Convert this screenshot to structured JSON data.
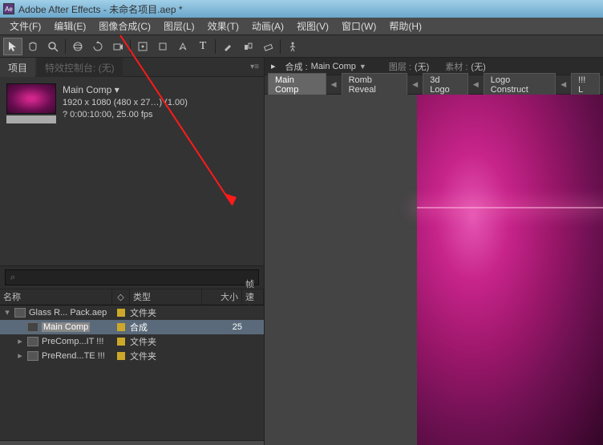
{
  "title": "Adobe After Effects - 未命名项目.aep *",
  "menu": [
    "文件(F)",
    "编辑(E)",
    "图像合成(C)",
    "图层(L)",
    "效果(T)",
    "动画(A)",
    "视图(V)",
    "窗口(W)",
    "帮助(H)"
  ],
  "panel": {
    "projectTab": "项目",
    "fxTab": "特效控制台:  (无)",
    "menuIcon": "▾≡"
  },
  "comp": {
    "name": "Main Comp ▾",
    "dims": "1920 x 1080  (480 x 27…)  (1.00)",
    "time": "? 0:00:10:00, 25.00 fps"
  },
  "search": {
    "placeholder": "⌕"
  },
  "cols": {
    "name": "名称",
    "tagIcon": "◇",
    "type": "类型",
    "size": "大小",
    "rate": "帧速率"
  },
  "rows": [
    {
      "tri": "▾",
      "icon": "folder",
      "label": "Glass R... Pack.aep",
      "type": "文件夹",
      "size": "",
      "sel": false,
      "indent": 0
    },
    {
      "tri": "",
      "icon": "comp",
      "label": "Main Comp",
      "type": "合成",
      "size": "25",
      "sel": true,
      "indent": 1
    },
    {
      "tri": "▸",
      "icon": "folder",
      "label": "PreComp...IT !!!",
      "type": "文件夹",
      "size": "",
      "sel": false,
      "indent": 1
    },
    {
      "tri": "▸",
      "icon": "folder",
      "label": "PreRend...TE !!!",
      "type": "文件夹",
      "size": "",
      "sel": false,
      "indent": 1
    }
  ],
  "right": {
    "compTab": "合成 :",
    "compName": "Main Comp",
    "layerLabel": "图层 :",
    "layerVal": "(无)",
    "matLabel": "素材 :",
    "matVal": "(无)",
    "crumbs": [
      "Main Comp",
      "Romb Reveal",
      "3d Logo",
      "Logo Construct",
      "!!! L"
    ]
  }
}
